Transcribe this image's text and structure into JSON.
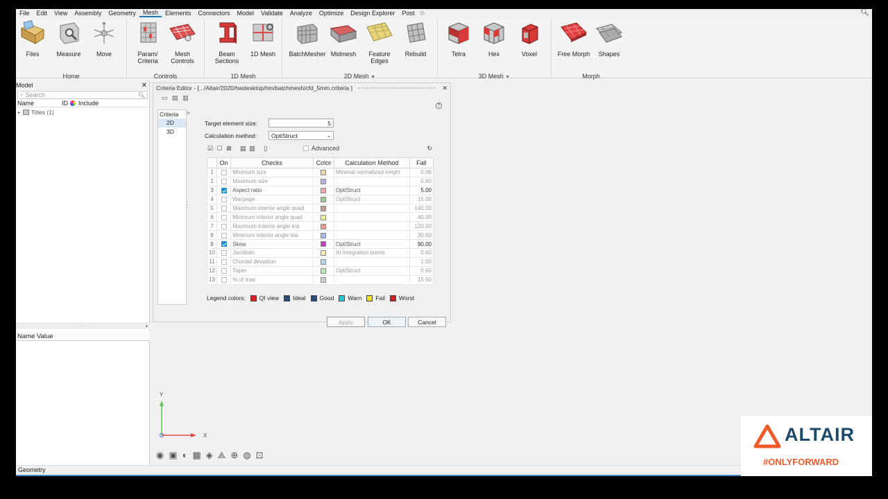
{
  "menu": [
    "File",
    "Edit",
    "View",
    "Assembly",
    "Geometry",
    "Mesh",
    "Elements",
    "Connectors",
    "Model",
    "Validate",
    "Analyze",
    "Optimize",
    "Design Explorer",
    "Post"
  ],
  "menu_active": "Mesh",
  "ribbon": {
    "home": {
      "label": "Home",
      "tools": [
        "Files",
        "Measure",
        "Move"
      ]
    },
    "controls": {
      "label": "Controls",
      "tools": [
        "Param/\nCriteria",
        "Mesh\nControls"
      ]
    },
    "mesh1d": {
      "label": "1D Mesh",
      "tools": [
        "Beam\nSections",
        "1D Mesh"
      ]
    },
    "mesh2d": {
      "label": "2D Mesh",
      "tools": [
        "BatchMesher",
        "Midmesh",
        "Feature\nEdges",
        "Rebuild"
      ]
    },
    "mesh3d": {
      "label": "3D Mesh",
      "tools": [
        "Tetra",
        "Hex",
        "Voxel"
      ]
    },
    "morph": {
      "label": "Morph",
      "tools": [
        "Free Morph",
        "Shapes"
      ]
    }
  },
  "left_panel": {
    "title": "Model",
    "search_placeholder": "Search",
    "col_name": "Name",
    "col_id": "ID",
    "col_include": "Include",
    "tree_item": "Titles (1)",
    "name_value_header": "Name Value"
  },
  "status": "Geometry",
  "axes": {
    "y": "Y",
    "x": "X"
  },
  "dialog": {
    "title": "Criteria Editor - [.../Altair/2020/hwdesktop/hm/batchmesh/cfd_5mm.criteria ]",
    "criteria_header": "Criteria",
    "criteria_items": [
      "2D",
      "3D"
    ],
    "target_label": "Target element size:",
    "target_value": "5",
    "calc_label": "Calculation method:",
    "calc_value": "OptiStruct",
    "advanced_label": "Advanced",
    "columns": {
      "on": "On",
      "checks": "Checks",
      "color": "Color",
      "method": "Calculation Method",
      "fail": "Fail"
    },
    "rows": [
      {
        "idx": "1",
        "on": false,
        "check": "Minimum size",
        "color": "#e9d8a8",
        "method": "Minimal normalized height",
        "fail": "0.06"
      },
      {
        "idx": "2",
        "on": false,
        "check": "Maximum size",
        "color": "#b8b0de",
        "method": "",
        "fail": "0.60"
      },
      {
        "idx": "3",
        "on": true,
        "check": "Aspect ratio",
        "color": "#f0a8a8",
        "method": "OptiStruct",
        "fail": "5.00"
      },
      {
        "idx": "4",
        "on": false,
        "check": "Warpage",
        "color": "#9ec79e",
        "method": "OptiStruct",
        "fail": "15.00"
      },
      {
        "idx": "5",
        "on": false,
        "check": "Maximum interior angle quad",
        "color": "#c89a90",
        "method": "",
        "fail": "140.00"
      },
      {
        "idx": "6",
        "on": false,
        "check": "Minimum interior angle quad",
        "color": "#eef09a",
        "method": "",
        "fail": "40.00"
      },
      {
        "idx": "7",
        "on": false,
        "check": "Maximum interior angle tria",
        "color": "#e89a8e",
        "method": "",
        "fail": "120.00"
      },
      {
        "idx": "8",
        "on": false,
        "check": "Minimum interior angle tria",
        "color": "#a6b8e8",
        "method": "",
        "fail": "30.00"
      },
      {
        "idx": "9",
        "on": true,
        "check": "Skew",
        "color": "#c83ac8",
        "method": "OptiStruct",
        "fail": "90.00"
      },
      {
        "idx": "10",
        "on": false,
        "check": "Jacobian",
        "color": "#f6e6b0",
        "method": "At integration points",
        "fail": "0.60"
      },
      {
        "idx": "11",
        "on": false,
        "check": "Chordal deviation",
        "color": "#b0d6f0",
        "method": "",
        "fail": "1.00"
      },
      {
        "idx": "12",
        "on": false,
        "check": "Taper",
        "color": "#b6ecb6",
        "method": "OptiStruct",
        "fail": "0.60"
      },
      {
        "idx": "13",
        "on": false,
        "check": "% of trias",
        "color": "#d0d0d0",
        "method": "",
        "fail": "15.00"
      }
    ],
    "legend_label": "Legend colors:",
    "legend": [
      {
        "name": "QI view",
        "color": "#d42020"
      },
      {
        "name": "Ideal",
        "color": "#2a4a6e"
      },
      {
        "name": "Good",
        "color": "#2a4a8a"
      },
      {
        "name": "Warn",
        "color": "#20c8e0"
      },
      {
        "name": "Fail",
        "color": "#f0e020"
      },
      {
        "name": "Worst",
        "color": "#d42020"
      }
    ],
    "buttons": {
      "apply": "Apply",
      "ok": "OK",
      "cancel": "Cancel"
    }
  },
  "logo": {
    "brand": "ALTAIR",
    "tagline": "#ONLYFORWARD",
    "color": "#f05a28"
  }
}
